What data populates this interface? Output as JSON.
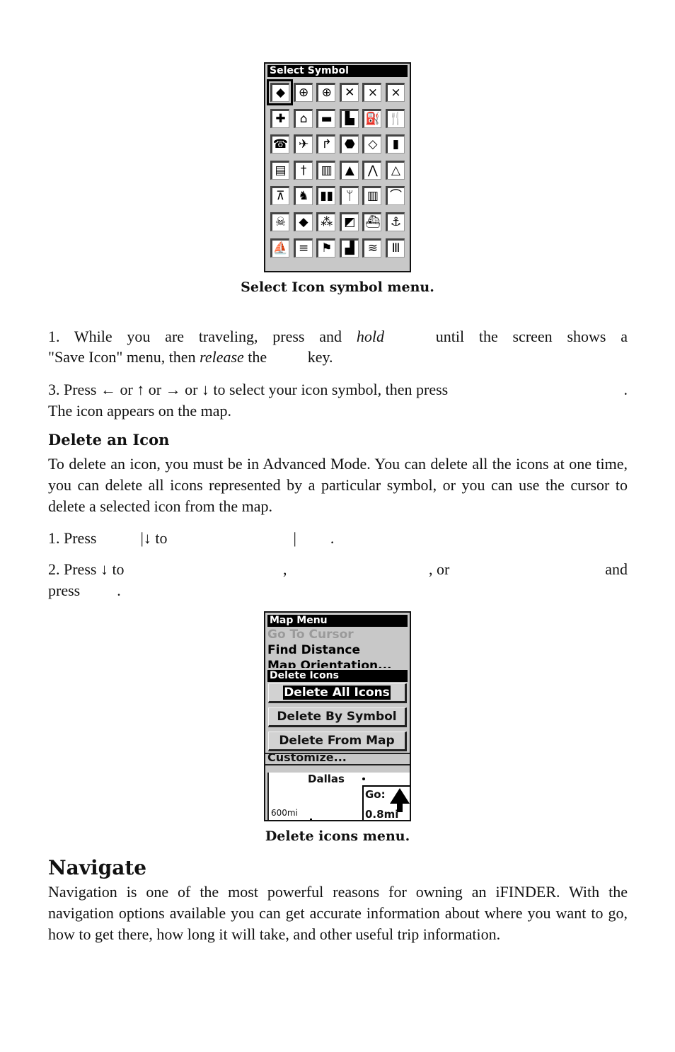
{
  "figure1": {
    "title": "Select Symbol",
    "selected_index": 0,
    "symbols": [
      [
        "diamond-solid-icon",
        "diamond-crosshair-icon",
        "diamond-crosshair-bold-icon",
        "x-mark-icon",
        "x-mark-outline-icon",
        "x-mark-outline-2-icon"
      ],
      [
        "medical-cross-icon",
        "house-icon",
        "car-icon",
        "building-icon",
        "fuel-pump-icon",
        "restaurant-icon"
      ],
      [
        "phone-icon",
        "airplane-icon",
        "turn-sign-icon",
        "stop-sign-icon",
        "warning-diamond-icon",
        "traffic-light-icon"
      ],
      [
        "flag-icon",
        "person-icon",
        "restroom-icon",
        "tree-icon",
        "mountain-icon",
        "tent-icon"
      ],
      [
        "picnic-table-icon",
        "deer-icon",
        "binoculars-icon",
        "grass-icon",
        "playground-icon",
        "bridge-icon"
      ],
      [
        "skull-crossbones-icon",
        "fish-icon",
        "fish-school-icon",
        "diver-flag-icon",
        "boat-ramp-icon",
        "anchor-icon"
      ],
      [
        "boat-icon",
        "boat-launch-icon",
        "buoy-icon",
        "factory-icon",
        "swimmer-icon",
        "dock-icon"
      ]
    ],
    "glyphs": [
      [
        "◆",
        "⊕",
        "⊕",
        "✕",
        "⨯",
        "⨯"
      ],
      [
        "✚",
        "⌂",
        "▬",
        "▙",
        "⛽",
        "🍴"
      ],
      [
        "☎",
        "✈",
        "↱",
        "⬣",
        "◇",
        "▮"
      ],
      [
        "▤",
        "†",
        "▥",
        "▲",
        "⋀",
        "△"
      ],
      [
        "⊼",
        "♞",
        "▮▮",
        "ᛘ",
        "▥",
        "⌒"
      ],
      [
        "☠",
        "◆",
        "⁂",
        "◩",
        "⛴",
        "⚓"
      ],
      [
        "⛵",
        "≡",
        "⚑",
        "▟",
        "≋",
        "Ⅲ"
      ]
    ],
    "caption": "Select Icon symbol menu."
  },
  "step1": {
    "a": "1. While you are traveling, press and ",
    "hold": "hold",
    "b": " until the screen shows a",
    "c": "\"Save Icon\" menu, then ",
    "release": "release",
    "d": " the",
    "e": " key."
  },
  "step3": {
    "line1": "3. Press ← or ↑ or → or ↓ to select your icon symbol, then press",
    "line1_end": ".",
    "line2": "The icon appears on the map."
  },
  "delete_section": {
    "heading": "Delete an Icon",
    "body": "To delete an icon, you must be in Advanced Mode. You can delete all the icons at one time, you can delete all icons represented by a particular symbol, or you can use the cursor to delete a selected icon from the map.",
    "step1": {
      "a": "1. Press",
      "b": "|↓ to",
      "c": "|",
      "d": "."
    },
    "step2": {
      "a": "2. Press ↓ to",
      "b": ",",
      "c": ", or",
      "d": "and",
      "e": "press",
      "f": "."
    }
  },
  "figure2": {
    "menu_title": "Map Menu",
    "menu_items": [
      {
        "label": "Go To Cursor",
        "disabled": true
      },
      {
        "label": "Find Distance",
        "disabled": false
      },
      {
        "label": "Map Orientation...",
        "disabled": false
      }
    ],
    "submenu_title": "Delete Icons",
    "buttons": [
      {
        "label": "Delete All Icons",
        "selected": true
      },
      {
        "label": "Delete By Symbol",
        "selected": false
      },
      {
        "label": "Delete From Map",
        "selected": false
      }
    ],
    "hidden_item": "Customize...",
    "map": {
      "city": "Dallas",
      "scale": "600mi",
      "go_label": "Go:",
      "go_distance": "0.8mi"
    },
    "caption": "Delete icons menu."
  },
  "navigate": {
    "heading": "Navigate",
    "body": "Navigation is one of the most powerful reasons for owning an iFINDER. With the navigation options available you can get accurate information about where you want to go, how to get there, how long it will take, and other useful trip information."
  }
}
